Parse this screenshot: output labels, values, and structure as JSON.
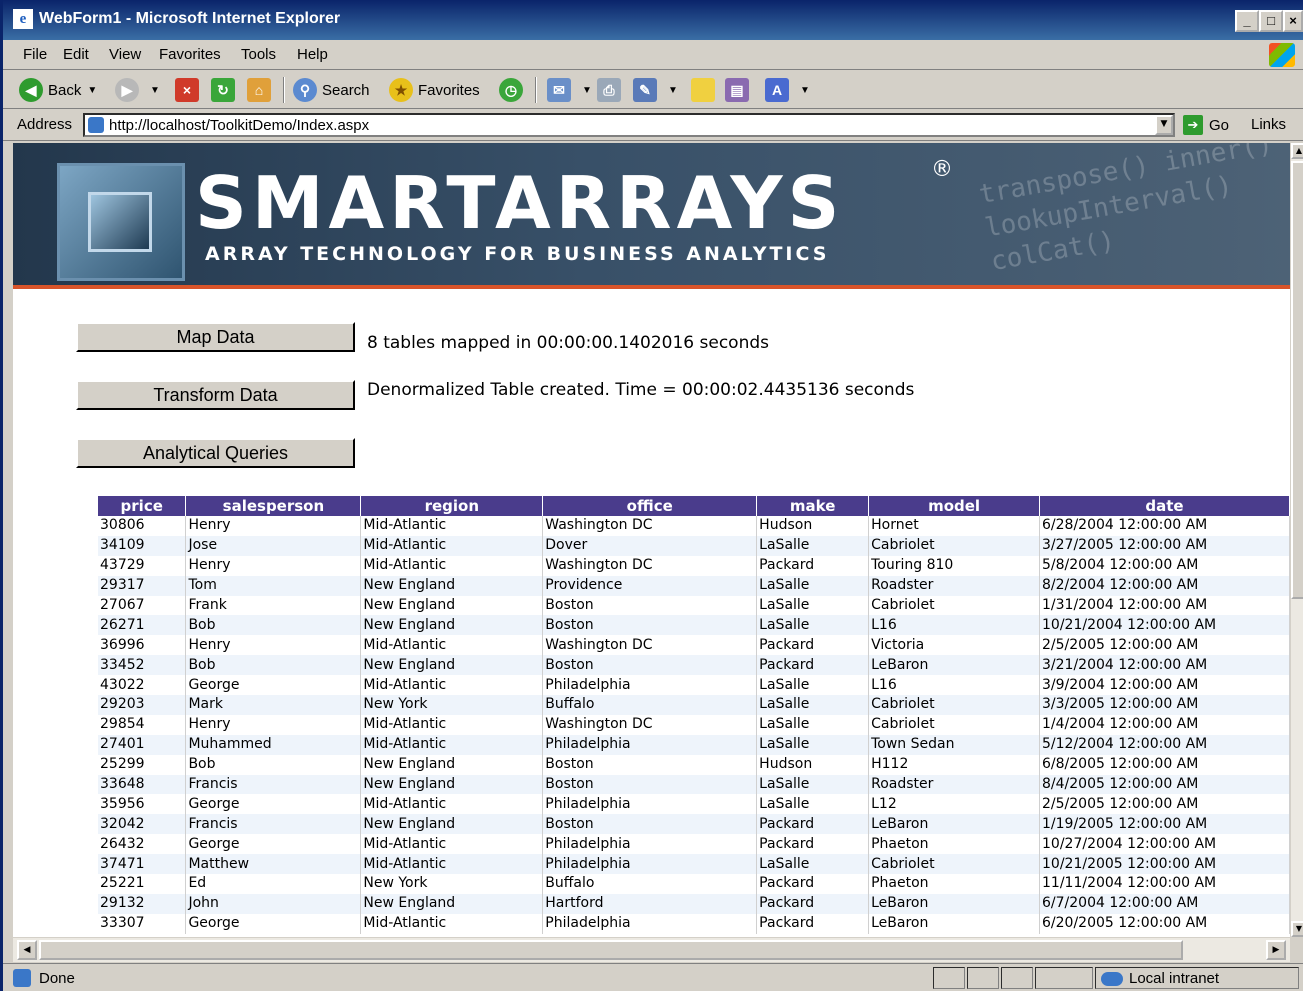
{
  "window": {
    "title": "WebForm1 - Microsoft Internet Explorer",
    "minimize": "_",
    "maximize": "□",
    "close": "×"
  },
  "menu": [
    "File",
    "Edit",
    "View",
    "Favorites",
    "Tools",
    "Help"
  ],
  "toolbar": {
    "back": "Back",
    "search": "Search",
    "favorites": "Favorites"
  },
  "address": {
    "label": "Address",
    "url": "http://localhost/ToolkitDemo/Index.aspx",
    "go": "Go",
    "links": "Links"
  },
  "banner": {
    "brand": "SMARTARRAYS",
    "registered": "®",
    "tagline": "ARRAY TECHNOLOGY FOR BUSINESS ANALYTICS",
    "code_words": "transpose() inner() lookupInterval() colCat()"
  },
  "actions": {
    "map_label": "Map Data",
    "map_status": "8 tables mapped in 00:00:00.1402016 seconds",
    "transform_label": "Transform Data",
    "transform_status": "Denormalized Table created. Time = 00:00:02.4435136 seconds",
    "queries_label": "Analytical Queries"
  },
  "table": {
    "columns": [
      "price",
      "salesperson",
      "region",
      "office",
      "make",
      "model",
      "date"
    ],
    "rows": [
      [
        "30806",
        "Henry",
        "Mid-Atlantic",
        "Washington DC",
        "Hudson",
        "Hornet",
        "6/28/2004 12:00:00 AM"
      ],
      [
        "34109",
        "Jose",
        "Mid-Atlantic",
        "Dover",
        "LaSalle",
        "Cabriolet",
        "3/27/2005 12:00:00 AM"
      ],
      [
        "43729",
        "Henry",
        "Mid-Atlantic",
        "Washington DC",
        "Packard",
        "Touring 810",
        "5/8/2004 12:00:00 AM"
      ],
      [
        "29317",
        "Tom",
        "New England",
        "Providence",
        "LaSalle",
        "Roadster",
        "8/2/2004 12:00:00 AM"
      ],
      [
        "27067",
        "Frank",
        "New England",
        "Boston",
        "LaSalle",
        "Cabriolet",
        "1/31/2004 12:00:00 AM"
      ],
      [
        "26271",
        "Bob",
        "New England",
        "Boston",
        "LaSalle",
        "L16",
        "10/21/2004 12:00:00 AM"
      ],
      [
        "36996",
        "Henry",
        "Mid-Atlantic",
        "Washington DC",
        "Packard",
        "Victoria",
        "2/5/2005 12:00:00 AM"
      ],
      [
        "33452",
        "Bob",
        "New England",
        "Boston",
        "Packard",
        "LeBaron",
        "3/21/2004 12:00:00 AM"
      ],
      [
        "43022",
        "George",
        "Mid-Atlantic",
        "Philadelphia",
        "LaSalle",
        "L16",
        "3/9/2004 12:00:00 AM"
      ],
      [
        "29203",
        "Mark",
        "New York",
        "Buffalo",
        "LaSalle",
        "Cabriolet",
        "3/3/2005 12:00:00 AM"
      ],
      [
        "29854",
        "Henry",
        "Mid-Atlantic",
        "Washington DC",
        "LaSalle",
        "Cabriolet",
        "1/4/2004 12:00:00 AM"
      ],
      [
        "27401",
        "Muhammed",
        "Mid-Atlantic",
        "Philadelphia",
        "LaSalle",
        "Town Sedan",
        "5/12/2004 12:00:00 AM"
      ],
      [
        "25299",
        "Bob",
        "New England",
        "Boston",
        "Hudson",
        "H112",
        "6/8/2005 12:00:00 AM"
      ],
      [
        "33648",
        "Francis",
        "New England",
        "Boston",
        "LaSalle",
        "Roadster",
        "8/4/2005 12:00:00 AM"
      ],
      [
        "35956",
        "George",
        "Mid-Atlantic",
        "Philadelphia",
        "LaSalle",
        "L12",
        "2/5/2005 12:00:00 AM"
      ],
      [
        "32042",
        "Francis",
        "New England",
        "Boston",
        "Packard",
        "LeBaron",
        "1/19/2005 12:00:00 AM"
      ],
      [
        "26432",
        "George",
        "Mid-Atlantic",
        "Philadelphia",
        "Packard",
        "Phaeton",
        "10/27/2004 12:00:00 AM"
      ],
      [
        "37471",
        "Matthew",
        "Mid-Atlantic",
        "Philadelphia",
        "LaSalle",
        "Cabriolet",
        "10/21/2005 12:00:00 AM"
      ],
      [
        "25221",
        "Ed",
        "New York",
        "Buffalo",
        "Packard",
        "Phaeton",
        "11/11/2004 12:00:00 AM"
      ],
      [
        "29132",
        "John",
        "New England",
        "Hartford",
        "Packard",
        "LeBaron",
        "6/7/2004 12:00:00 AM"
      ],
      [
        "33307",
        "George",
        "Mid-Atlantic",
        "Philadelphia",
        "Packard",
        "LeBaron",
        "6/20/2005 12:00:00 AM"
      ]
    ]
  },
  "status": {
    "text": "Done",
    "zone": "Local intranet"
  },
  "colors": {
    "header_bg": "#4a3c8c",
    "banner_accent": "#d9542a",
    "alt_row": "#eef4fb"
  }
}
